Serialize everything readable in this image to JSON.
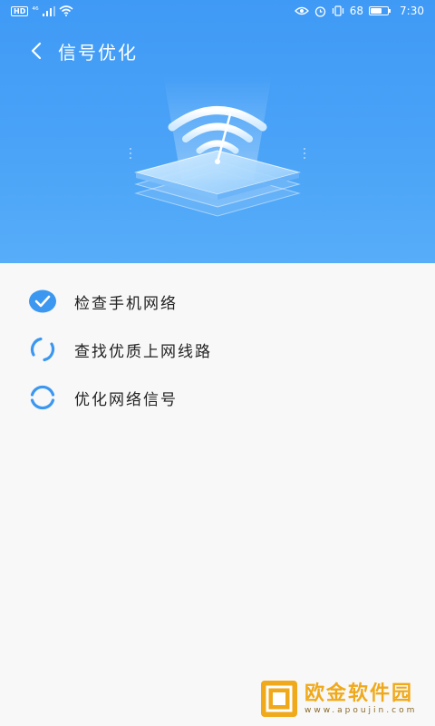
{
  "status_bar": {
    "hd_label": "HD",
    "signal_label": "⁴⁶",
    "battery_percent_text": "68",
    "battery_level": 0.68,
    "time": "7:30"
  },
  "header": {
    "title": "信号优化",
    "back_icon": "chevron-left-icon"
  },
  "colors": {
    "hero_blue": "#3f9af6",
    "check_blue": "#3b97f0",
    "text_dark": "#222222",
    "watermark_orange": "#f0a91b"
  },
  "steps": [
    {
      "label": "检查手机网络",
      "state": "done",
      "icon": "check-circle-icon"
    },
    {
      "label": "查找优质上网线路",
      "state": "in-progress",
      "icon": "spinner-icon"
    },
    {
      "label": "优化网络信号",
      "state": "pending",
      "icon": "spinner-icon"
    }
  ],
  "watermark": {
    "main": "欧金软件园",
    "sub": "www.apoujin.com"
  }
}
